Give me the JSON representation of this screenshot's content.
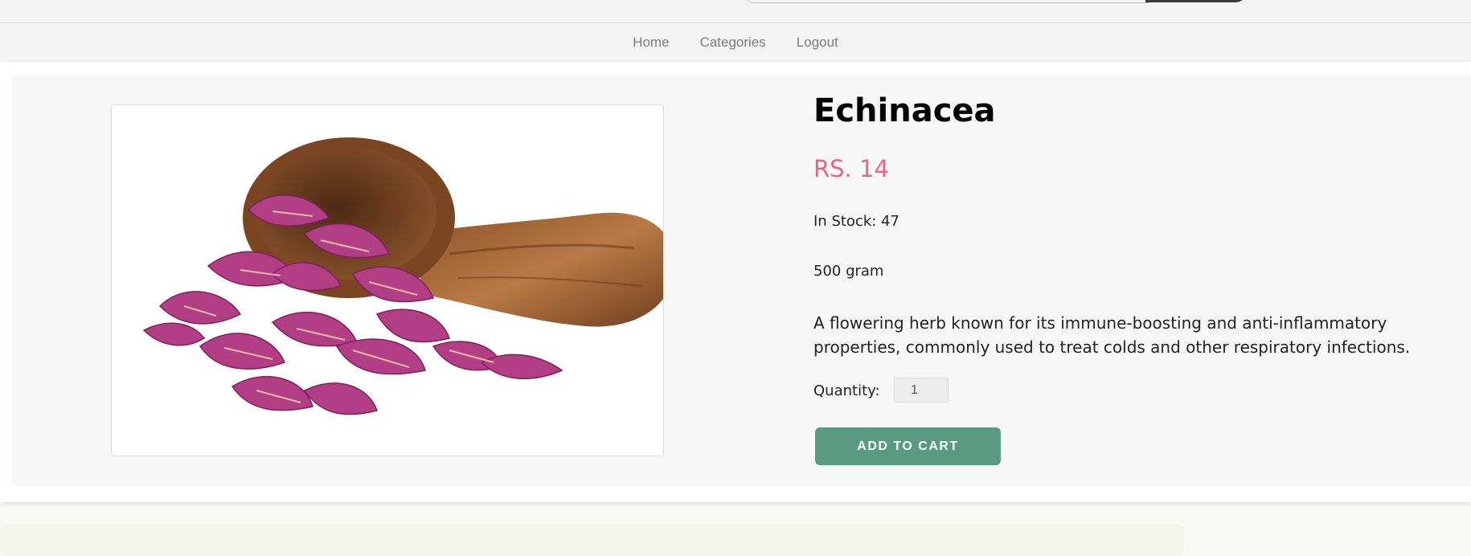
{
  "nav": {
    "items": [
      {
        "label": "Home"
      },
      {
        "label": "Categories"
      },
      {
        "label": "Logout"
      }
    ]
  },
  "product": {
    "name": "Echinacea",
    "price": "RS. 14",
    "stock": "In Stock: 47",
    "weight": "500 gram",
    "description": "A flowering herb known for its immune-boosting and anti-inflammatory properties, commonly used to treat colds and other respiratory infections.",
    "image_subject": "dried echinacea petals on a wooden scoop"
  },
  "quantity": {
    "label": "Quantity:",
    "value": "1"
  },
  "actions": {
    "add_to_cart": "ADD TO CART"
  },
  "colors": {
    "price": "#e8677b",
    "button": "#5a9a82",
    "petal": "#b23f86"
  }
}
